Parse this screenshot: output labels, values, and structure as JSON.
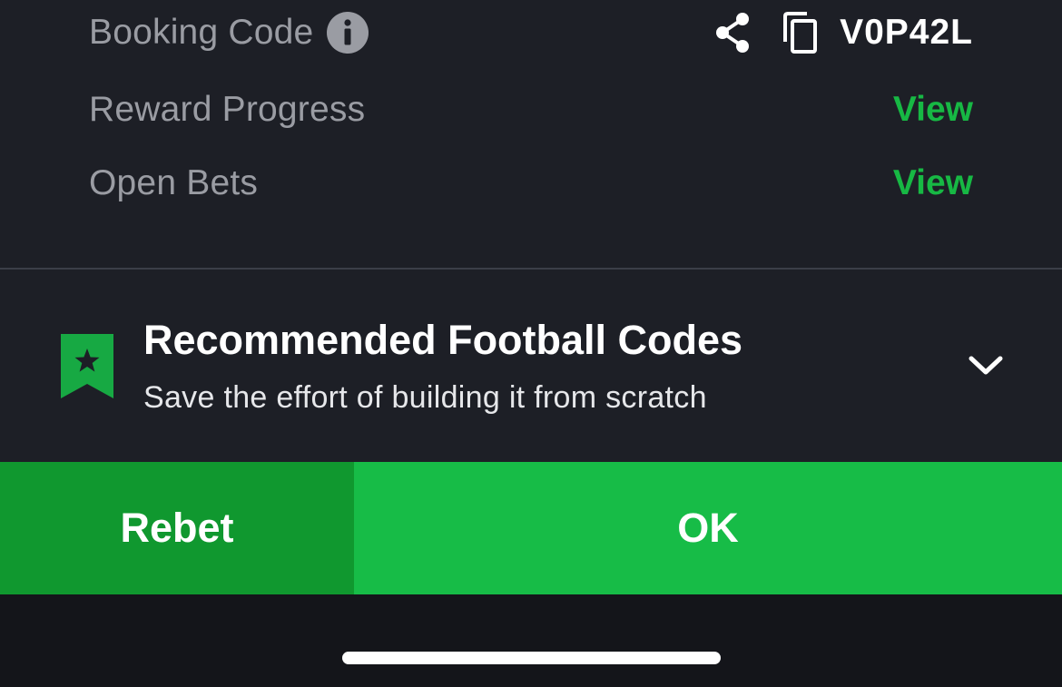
{
  "booking": {
    "label": "Booking Code",
    "code": "V0P42L",
    "icons": [
      "info-icon",
      "share-icon",
      "copy-icon"
    ]
  },
  "reward_progress": {
    "label": "Reward Progress",
    "link": "View"
  },
  "open_bets": {
    "label": "Open Bets",
    "link": "View"
  },
  "recommended": {
    "title": "Recommended Football Codes",
    "subtitle": "Save the effort of building it from scratch",
    "icons": [
      "bookmark-star-icon",
      "chevron-down-icon"
    ]
  },
  "actions": {
    "rebet_label": "Rebet",
    "ok_label": "OK"
  },
  "colors": {
    "background": "#1d1f26",
    "accent_green": "#17bc47",
    "dark_green": "#10982f",
    "muted_text": "#9a9ca3"
  }
}
